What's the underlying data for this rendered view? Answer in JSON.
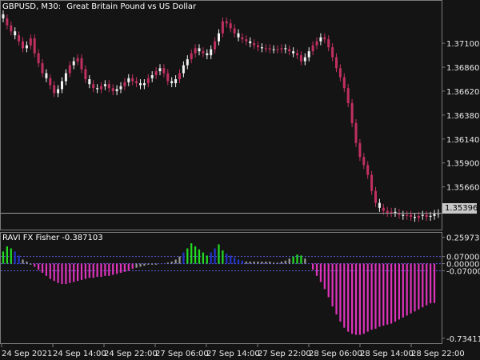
{
  "chart_header": {
    "symbol_timeframe": "GBPUSD, M30:",
    "instrument_name": "Great Britain Pound vs US Dollar"
  },
  "indicator_header": {
    "name_value": "RAVI FX Fisher -0.387103"
  },
  "current_price": "1.35396",
  "colors": {
    "background": "#141414",
    "bull_candle": "#f2f2f2",
    "bear_candle": "#c0305f",
    "frame": "#7a7a7a",
    "price_line": "#9a9a9a",
    "hist_green": "#22dd22",
    "hist_blue": "#2233cc",
    "hist_gray": "#9a9a9a",
    "hist_magenta": "#dd33bb",
    "level_line": "#5a5adc"
  },
  "chart_data": [
    {
      "type": "candlestick",
      "title": "GBPUSD, M30: Great Britain Pound vs US Dollar",
      "y_ticks": [
        "1.37100",
        "1.36860",
        "1.36620",
        "1.36380",
        "1.36140",
        "1.35900",
        "1.35660"
      ],
      "ylim": [
        1.3524,
        1.3751
      ],
      "x_ticks": [
        "24 Sep 2021",
        "24 Sep 14:00",
        "24 Sep 22:00",
        "27 Sep 06:00",
        "27 Sep 14:00",
        "27 Sep 22:00",
        "28 Sep 06:00",
        "28 Sep 14:00",
        "28 Sep 22:00"
      ],
      "last_price": 1.35396,
      "closes": [
        1.3735,
        1.3728,
        1.3722,
        1.3718,
        1.3712,
        1.3705,
        1.3708,
        1.3715,
        1.37,
        1.369,
        1.368,
        1.3675,
        1.3668,
        1.366,
        1.3664,
        1.3672,
        1.368,
        1.3688,
        1.3692,
        1.3695,
        1.3684,
        1.3674,
        1.3669,
        1.3665,
        1.3664,
        1.3667,
        1.3669,
        1.3665,
        1.3662,
        1.3664,
        1.3667,
        1.3671,
        1.3675,
        1.3672,
        1.367,
        1.3668,
        1.367,
        1.3675,
        1.3678,
        1.3682,
        1.3685,
        1.368,
        1.3672,
        1.367,
        1.3674,
        1.368,
        1.3688,
        1.3694,
        1.37,
        1.3705,
        1.3702,
        1.37,
        1.3698,
        1.3704,
        1.3712,
        1.372,
        1.3732,
        1.373,
        1.3725,
        1.372,
        1.3716,
        1.3714,
        1.3712,
        1.371,
        1.3708,
        1.3706,
        1.3705,
        1.3705,
        1.3704,
        1.3704,
        1.3704,
        1.3705,
        1.3704,
        1.3702,
        1.37,
        1.3698,
        1.3692,
        1.3696,
        1.3702,
        1.3708,
        1.3712,
        1.3716,
        1.3714,
        1.3706,
        1.3696,
        1.3685,
        1.3676,
        1.3665,
        1.365,
        1.363,
        1.361,
        1.3596,
        1.3588,
        1.3578,
        1.3562,
        1.355,
        1.3545,
        1.3542,
        1.354,
        1.3541,
        1.354,
        1.3538,
        1.3537,
        1.3538,
        1.3536,
        1.3535,
        1.3537,
        1.3538,
        1.3536,
        1.3537,
        1.3539,
        1.35396
      ],
      "bearish": [
        false,
        true,
        true,
        false,
        true,
        true,
        false,
        true,
        true,
        true,
        true,
        false,
        true,
        true,
        false,
        false,
        false,
        true,
        false,
        true,
        true,
        true,
        false,
        true,
        false,
        true,
        false,
        true,
        true,
        false,
        false,
        true,
        false,
        true,
        true,
        false,
        false,
        true,
        false,
        true,
        false,
        true,
        true,
        false,
        false,
        true,
        false,
        false,
        true,
        true,
        false,
        true,
        false,
        false,
        true,
        false,
        true,
        true,
        true,
        true,
        false,
        true,
        true,
        false,
        true,
        true,
        false,
        true,
        true,
        false,
        true,
        true,
        false,
        true,
        false,
        true,
        true,
        false,
        false,
        true,
        true,
        false,
        true,
        true,
        true,
        true,
        true,
        true,
        true,
        true,
        true,
        true,
        true,
        true,
        true,
        true,
        false,
        true,
        true,
        true,
        false,
        true,
        false,
        true,
        true,
        false,
        true,
        false,
        true,
        false,
        false
      ]
    },
    {
      "type": "bar",
      "title": "RAVI FX Fisher -0.387103",
      "y_ticks": [
        "0.259735",
        "0.070000",
        "0.000000",
        "-0.070000",
        "-0.734112"
      ],
      "ylim": [
        -0.775,
        0.28
      ],
      "levels": [
        0.07,
        0.0,
        -0.07
      ],
      "values": [
        0.12,
        0.17,
        0.15,
        0.12,
        0.08,
        0.04,
        0.02,
        -0.01,
        -0.03,
        -0.06,
        -0.09,
        -0.12,
        -0.15,
        -0.17,
        -0.19,
        -0.2,
        -0.2,
        -0.19,
        -0.18,
        -0.17,
        -0.16,
        -0.15,
        -0.14,
        -0.14,
        -0.13,
        -0.13,
        -0.12,
        -0.12,
        -0.11,
        -0.1,
        -0.09,
        -0.08,
        -0.07,
        -0.05,
        -0.04,
        -0.03,
        -0.02,
        -0.01,
        -0.01,
        -0.01,
        0.0,
        0.0,
        0.01,
        0.02,
        0.04,
        0.07,
        0.11,
        0.15,
        0.2,
        0.17,
        0.14,
        0.11,
        0.08,
        0.11,
        0.15,
        0.19,
        0.13,
        0.1,
        0.08,
        0.06,
        0.04,
        0.03,
        0.02,
        0.02,
        0.02,
        0.02,
        0.02,
        0.02,
        0.02,
        0.01,
        0.01,
        0.02,
        0.03,
        0.05,
        0.07,
        0.09,
        0.08,
        0.05,
        0.0,
        -0.06,
        -0.12,
        -0.18,
        -0.25,
        -0.33,
        -0.42,
        -0.5,
        -0.57,
        -0.63,
        -0.67,
        -0.69,
        -0.7,
        -0.7,
        -0.69,
        -0.67,
        -0.65,
        -0.64,
        -0.62,
        -0.61,
        -0.6,
        -0.59,
        -0.57,
        -0.55,
        -0.53,
        -0.51,
        -0.49,
        -0.47,
        -0.45,
        -0.43,
        -0.41,
        -0.39,
        -0.387
      ],
      "bar_colors": [
        "green",
        "green",
        "green",
        "blue",
        "blue",
        "gray",
        "gray",
        "gray",
        "magenta",
        "magenta",
        "magenta",
        "magenta",
        "magenta",
        "magenta",
        "magenta",
        "magenta",
        "magenta",
        "magenta",
        "magenta",
        "magenta",
        "magenta",
        "magenta",
        "magenta",
        "magenta",
        "magenta",
        "magenta",
        "magenta",
        "magenta",
        "magenta",
        "magenta",
        "magenta",
        "magenta",
        "magenta",
        "magenta",
        "gray",
        "gray",
        "gray",
        "gray",
        "gray",
        "gray",
        "gray",
        "gray",
        "gray",
        "gray",
        "gray",
        "gray",
        "blue",
        "green",
        "green",
        "green",
        "green",
        "green",
        "green",
        "blue",
        "blue",
        "green",
        "green",
        "blue",
        "blue",
        "blue",
        "blue",
        "blue",
        "gray",
        "gray",
        "gray",
        "gray",
        "gray",
        "gray",
        "gray",
        "gray",
        "gray",
        "gray",
        "gray",
        "gray",
        "green",
        "green",
        "green",
        "gray",
        "gray",
        "magenta",
        "magenta",
        "magenta",
        "magenta",
        "magenta",
        "magenta",
        "magenta",
        "magenta",
        "magenta",
        "magenta",
        "magenta",
        "magenta",
        "magenta",
        "magenta",
        "magenta",
        "magenta",
        "magenta",
        "magenta",
        "magenta",
        "magenta",
        "magenta",
        "magenta",
        "magenta",
        "magenta",
        "magenta",
        "magenta",
        "magenta",
        "magenta",
        "magenta",
        "magenta",
        "magenta",
        "magenta"
      ]
    }
  ]
}
